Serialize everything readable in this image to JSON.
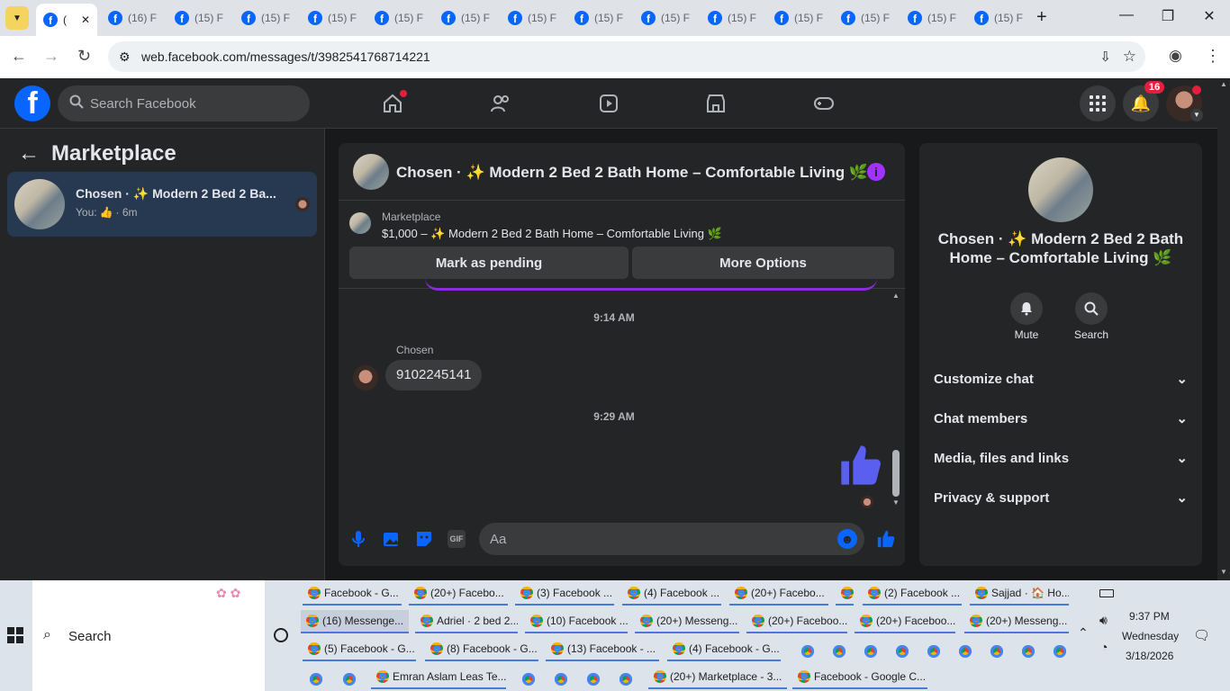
{
  "browser": {
    "tabs": [
      {
        "label": "("
      },
      {
        "label": "(16) F"
      },
      {
        "label": "(15) F"
      },
      {
        "label": "(15) F"
      },
      {
        "label": "(15) F"
      },
      {
        "label": "(15) F"
      },
      {
        "label": "(15) F"
      },
      {
        "label": "(15) F"
      },
      {
        "label": "(15) F"
      },
      {
        "label": "(15) F"
      },
      {
        "label": "(15) F"
      },
      {
        "label": "(15) F"
      },
      {
        "label": "(15) F"
      },
      {
        "label": "(15) F"
      },
      {
        "label": "(15) F"
      }
    ],
    "url": "web.facebook.com/messages/t/3982541768714221"
  },
  "fb": {
    "search_placeholder": "Search Facebook",
    "notif_count": "16"
  },
  "left": {
    "title": "Marketplace",
    "conv_title": "Chosen · ✨ Modern 2 Bed 2 Ba...",
    "conv_preview_you": "You:",
    "conv_time": "· 6m"
  },
  "chat": {
    "header_title": "Chosen · ✨ Modern 2 Bed 2 Bath Home – Comfortable Living 🌿",
    "listing_source": "Marketplace",
    "listing_title": "$1,000 – ✨ Modern 2 Bed 2 Bath Home – Comfortable Living 🌿",
    "mark_pending": "Mark as pending",
    "more_options": "More Options",
    "time1": "9:14 AM",
    "sender": "Chosen",
    "message": "9102245141",
    "time2": "9:29 AM",
    "input_placeholder": "Aa"
  },
  "info": {
    "title": "Chosen · ✨ Modern 2 Bed 2 Bath Home – Comfortable Living 🌿",
    "mute": "Mute",
    "search": "Search",
    "sections": [
      "Customize chat",
      "Chat members",
      "Media, files and links",
      "Privacy & support"
    ]
  },
  "taskbar": {
    "search": "Search",
    "row1": [
      "Facebook - G...",
      "(20+) Facebo...",
      "(3) Facebook ...",
      "(4) Facebook ...",
      "(20+) Facebo...",
      "",
      "(2) Facebook ...",
      "Sajjad · 🏠 Ho..."
    ],
    "row2": [
      "(16) Messenge...",
      "Adriel · 2 bed 2...",
      "(10) Facebook ...",
      "(20+) Messeng...",
      "(20+) Faceboo...",
      "(20+) Faceboo...",
      "(20+) Messeng..."
    ],
    "row3": [
      "(5) Facebook - G...",
      "(8) Facebook - G...",
      "(13) Facebook - ...",
      "(4) Facebook - G..."
    ],
    "row4": [
      "Emran Aslam Leas Te...",
      "(20+) Marketplace - 3...",
      "Facebook - Google C..."
    ],
    "time": "9:37 PM",
    "day": "Wednesday",
    "date": "3/18/2026"
  }
}
